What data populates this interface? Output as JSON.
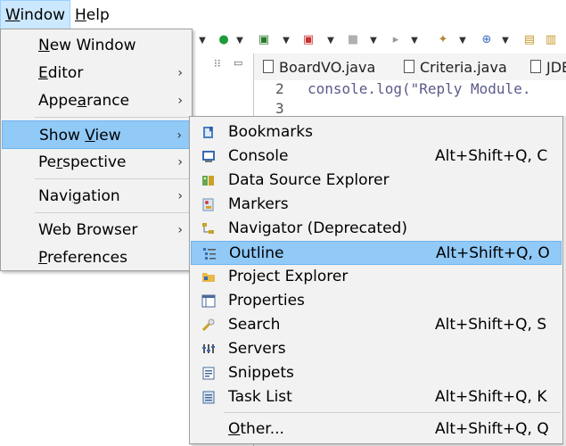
{
  "menubar": {
    "window": "Window",
    "window_u": "W",
    "window_rest": "indow",
    "help_u": "H",
    "help_rest": "elp"
  },
  "editor": {
    "tabs": [
      "BoardVO.java",
      "Criteria.java",
      "JDE"
    ],
    "line_numbers": [
      "2",
      "3"
    ],
    "code_line": "console.log(\"Reply Module."
  },
  "window_menu": {
    "items": [
      {
        "u": "N",
        "rest": "ew Window",
        "submenu": false
      },
      {
        "u": "E",
        "rest": "ditor",
        "submenu": true
      },
      {
        "pre": "Appe",
        "u": "a",
        "rest": "rance",
        "submenu": true
      },
      {
        "pre": "Show ",
        "u": "V",
        "rest": "iew",
        "submenu": true,
        "highlighted": true
      },
      {
        "pre": "Pe",
        "u": "r",
        "rest": "spective",
        "submenu": true
      },
      {
        "pre": "Navi",
        "u": "g",
        "rest": "ation",
        "submenu": true
      },
      {
        "pre": "Web Browser",
        "u": "",
        "rest": "",
        "submenu": true
      },
      {
        "u": "P",
        "rest": "references",
        "submenu": false
      }
    ]
  },
  "show_view_menu": {
    "items": [
      {
        "label": "Bookmarks",
        "shortcut": "",
        "icon": "bookmark-icon"
      },
      {
        "label": "Console",
        "shortcut": "Alt+Shift+Q, C",
        "icon": "console-icon"
      },
      {
        "label": "Data Source Explorer",
        "shortcut": "",
        "icon": "database-icon"
      },
      {
        "label": "Markers",
        "shortcut": "",
        "icon": "markers-icon"
      },
      {
        "label": "Navigator (Deprecated)",
        "shortcut": "",
        "icon": "navigator-icon"
      },
      {
        "label": "Outline",
        "shortcut": "Alt+Shift+Q, O",
        "icon": "outline-icon",
        "highlighted": true
      },
      {
        "label": "Project Explorer",
        "shortcut": "",
        "icon": "project-explorer-icon"
      },
      {
        "label": "Properties",
        "shortcut": "",
        "icon": "properties-icon"
      },
      {
        "label": "Search",
        "shortcut": "Alt+Shift+Q, S",
        "icon": "search-icon"
      },
      {
        "label": "Servers",
        "shortcut": "",
        "icon": "servers-icon"
      },
      {
        "label": "Snippets",
        "shortcut": "",
        "icon": "snippets-icon"
      },
      {
        "label": "Task List",
        "shortcut": "Alt+Shift+Q, K",
        "icon": "task-list-icon"
      },
      {
        "label": "Other...",
        "u": "O",
        "rest": "ther...",
        "shortcut": "Alt+Shift+Q, Q",
        "icon": ""
      }
    ]
  },
  "colors": {
    "highlight": "#91c9f7",
    "menu_bg": "#f2f2f2",
    "menubar_active": "#cce8ff"
  }
}
